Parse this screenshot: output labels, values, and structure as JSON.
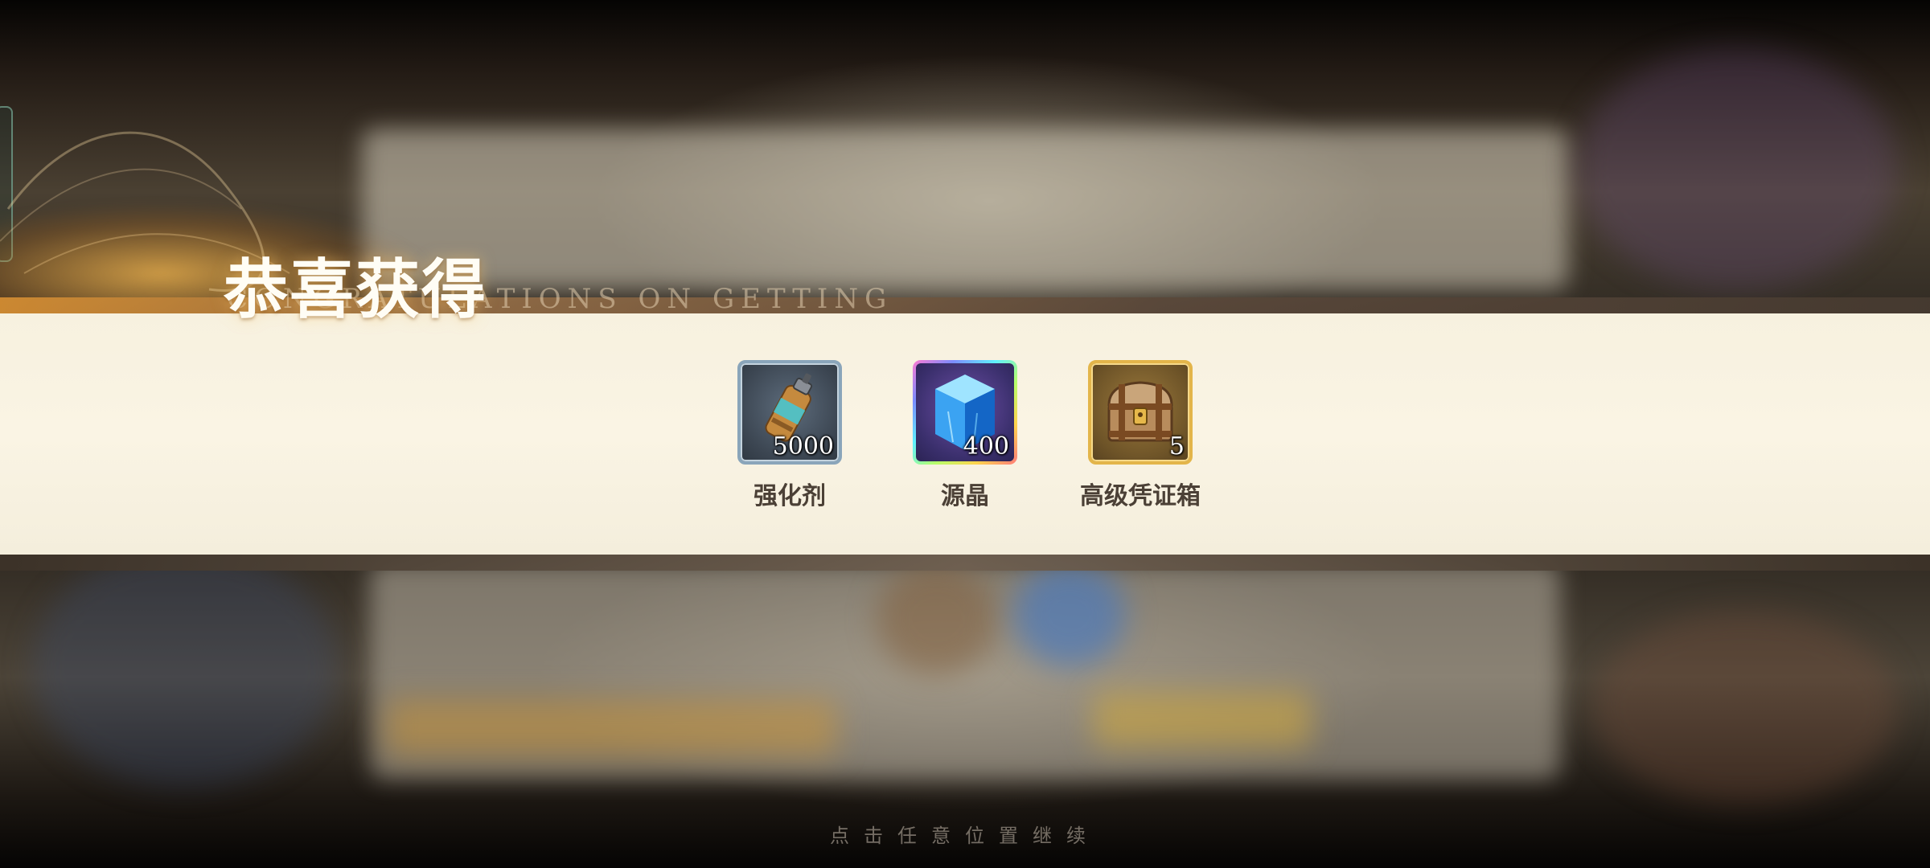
{
  "title": "恭喜获得",
  "subtitle": "CONGRATULATIONS ON GETTING",
  "rewards": [
    {
      "name": "强化剂",
      "count": "5000",
      "icon": "enhancer-bottle-icon",
      "rarity": "blue"
    },
    {
      "name": "源晶",
      "count": "400",
      "icon": "source-crystal-icon",
      "rarity": "rainbow"
    },
    {
      "name": "高级凭证箱",
      "count": "5",
      "icon": "treasure-chest-icon",
      "rarity": "gold"
    }
  ],
  "hint": "点击任意位置继续",
  "colors": {
    "banner": "#f7f1df",
    "title": "#fffdf5",
    "label": "#4b4036",
    "frame_blue": "#8aa5ba",
    "frame_gold": "#e3b54a"
  }
}
